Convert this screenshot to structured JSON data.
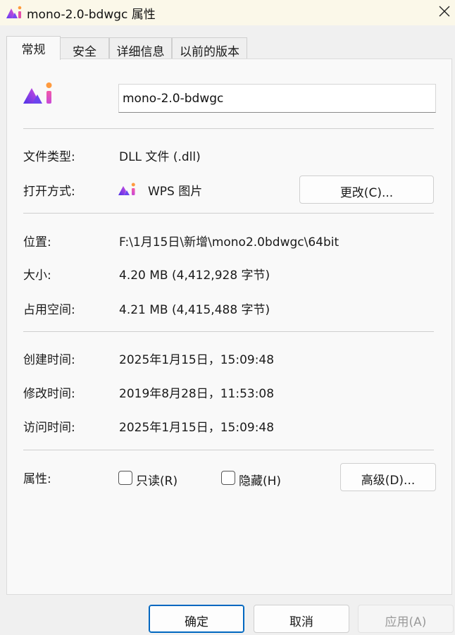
{
  "window": {
    "title": "mono-2.0-bdwgc 属性",
    "close_icon": "close-icon",
    "app_icon": "wps-picture-icon"
  },
  "tabs": [
    {
      "label": "常规",
      "active": true
    },
    {
      "label": "安全",
      "active": false
    },
    {
      "label": "详细信息",
      "active": false
    },
    {
      "label": "以前的版本",
      "active": false
    }
  ],
  "general": {
    "file_name": "mono-2.0-bdwgc",
    "file_type_label": "文件类型:",
    "file_type_value": "DLL 文件 (.dll)",
    "opens_with_label": "打开方式:",
    "opens_with_value": "WPS 图片",
    "change_button": "更改(C)...",
    "location_label": "位置:",
    "location_value": "F:\\1月15日\\新增\\mono2.0bdwgc\\64bit",
    "size_label": "大小:",
    "size_value": "4.20 MB (4,412,928 字节)",
    "size_on_disk_label": "占用空间:",
    "size_on_disk_value": "4.21 MB (4,415,488 字节)",
    "created_label": "创建时间:",
    "created_value": "2025年1月15日，15:09:48",
    "modified_label": "修改时间:",
    "modified_value": "2019年8月28日，11:53:08",
    "accessed_label": "访问时间:",
    "accessed_value": "2025年1月15日，15:09:48",
    "attributes_label": "属性:",
    "readonly_label": "只读(R)",
    "readonly_checked": false,
    "hidden_label": "隐藏(H)",
    "hidden_checked": false,
    "advanced_button": "高级(D)..."
  },
  "footer": {
    "ok": "确定",
    "cancel": "取消",
    "apply": "应用(A)"
  },
  "colors": {
    "titlebar_bg": "#fbf8e9",
    "panel_bg": "#f9f9f9",
    "ok_border": "#0067c0",
    "disabled_text": "#9a9a9a"
  }
}
